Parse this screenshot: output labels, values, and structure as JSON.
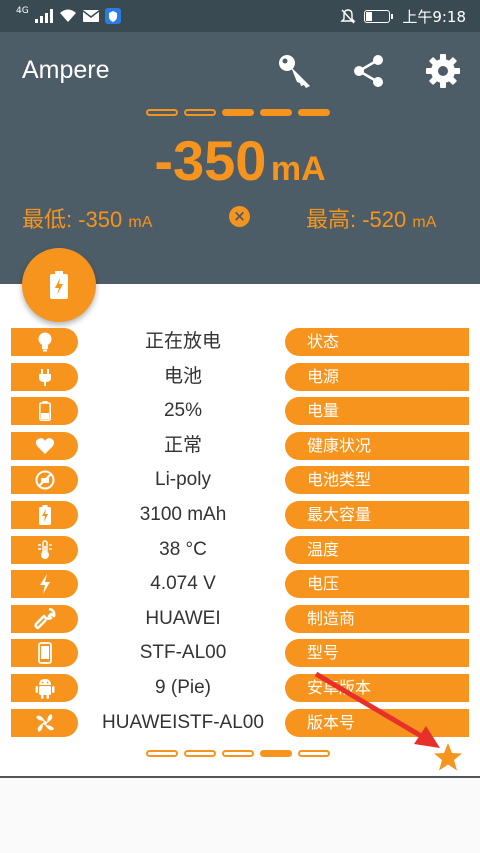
{
  "status_bar": {
    "network": "4G",
    "time": "上午9:18"
  },
  "header": {
    "app_title": "Ampere",
    "current": {
      "value": "-350",
      "unit": "mA"
    },
    "min": {
      "label": "最低: -350",
      "unit": "mA"
    },
    "max": {
      "label": "最高: -520",
      "unit": "mA"
    },
    "reset_symbol": "×",
    "top_pager_active_index": 2
  },
  "rows": [
    {
      "icon": "lightbulb-icon",
      "value": "正在放电",
      "label": "状态"
    },
    {
      "icon": "plug-icon",
      "value": "电池",
      "label": "电源"
    },
    {
      "icon": "battery-level-icon",
      "value": "25%",
      "label": "电量"
    },
    {
      "icon": "heart-icon",
      "value": "正常",
      "label": "健康状况"
    },
    {
      "icon": "battery-type-icon",
      "value": "Li-poly",
      "label": "电池类型"
    },
    {
      "icon": "battery-capacity-icon",
      "value": "3100 mAh",
      "label": "最大容量"
    },
    {
      "icon": "thermometer-icon",
      "value": "38 °C",
      "label": "温度"
    },
    {
      "icon": "bolt-icon",
      "value": "4.074 V",
      "label": "电压"
    },
    {
      "icon": "wrench-icon",
      "value": "HUAWEI",
      "label": "制造商"
    },
    {
      "icon": "phone-icon",
      "value": "STF-AL00",
      "label": "型号"
    },
    {
      "icon": "android-icon",
      "value": "9 (Pie)",
      "label": "安卓版本"
    },
    {
      "icon": "fan-icon",
      "value": "HUAWEISTF-AL00",
      "label": "版本号"
    }
  ],
  "bottom_pager_active_index": 3,
  "colors": {
    "accent": "#f7941d",
    "header_bg": "#4d5d67",
    "status_bg": "#3a4a53"
  }
}
